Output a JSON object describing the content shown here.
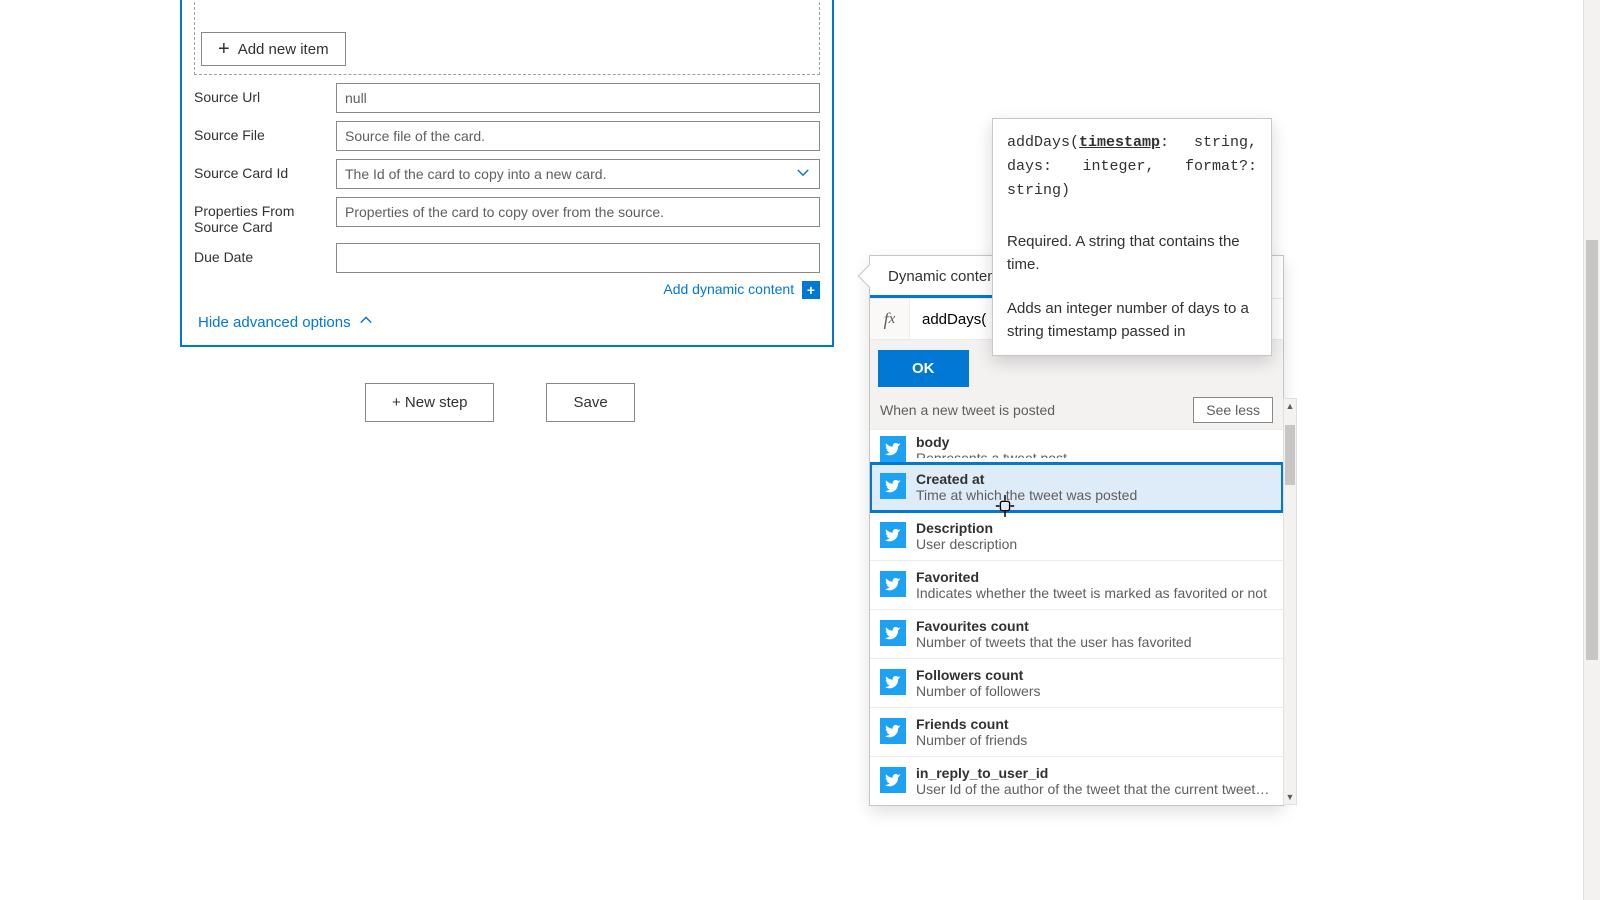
{
  "form": {
    "add_new_item": "Add new item",
    "fields": {
      "source_url": {
        "label": "Source Url",
        "value": "null"
      },
      "source_file": {
        "label": "Source File",
        "placeholder": "Source file of the card."
      },
      "source_card_id": {
        "label": "Source Card Id",
        "placeholder": "The Id of the card to copy into a new card."
      },
      "properties_from_source": {
        "label": "Properties From Source Card",
        "placeholder": "Properties of the card to copy over from the source."
      },
      "due_date": {
        "label": "Due Date",
        "value": ""
      }
    },
    "add_dynamic_content": "Add dynamic content",
    "hide_advanced": "Hide advanced options"
  },
  "buttons": {
    "new_step": "+ New step",
    "save": "Save"
  },
  "dc_panel": {
    "tab_label": "Dynamic content",
    "fx_value": "addDays(",
    "ok": "OK",
    "group_title": "When a new tweet is posted",
    "see_less": "See less",
    "items": [
      {
        "title": "body",
        "desc": "Represents a tweet post"
      },
      {
        "title": "Created at",
        "desc": "Time at which the tweet was posted"
      },
      {
        "title": "Description",
        "desc": "User description"
      },
      {
        "title": "Favorited",
        "desc": "Indicates whether the tweet is marked as favorited or not"
      },
      {
        "title": "Favourites count",
        "desc": "Number of tweets that the user has favorited"
      },
      {
        "title": "Followers count",
        "desc": "Number of followers"
      },
      {
        "title": "Friends count",
        "desc": "Number of friends"
      },
      {
        "title": "in_reply_to_user_id",
        "desc": "User Id of the author of the tweet that the current tweet i..."
      }
    ]
  },
  "tooltip": {
    "sig_fn": "addDays",
    "sig_arg1": "timestamp",
    "sig_rest": ": string, days: integer, format?: string)",
    "required": "Required. A string that contains the time.",
    "description": "Adds an integer number of days to a string timestamp passed in"
  }
}
